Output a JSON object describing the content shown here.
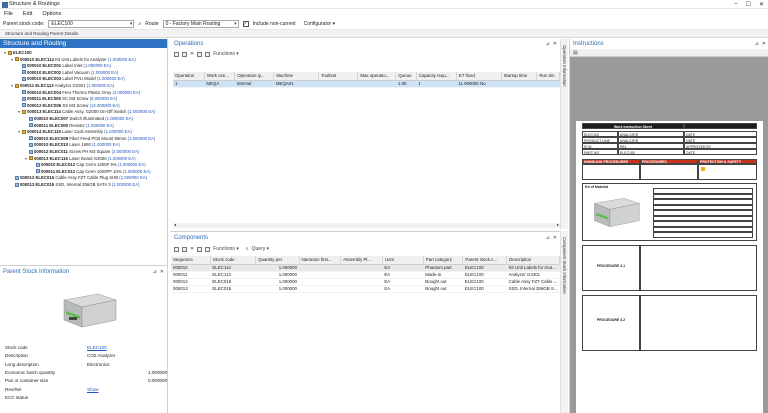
{
  "window": {
    "title": "Structure & Routings",
    "controls": [
      "–",
      "☐",
      "✕"
    ]
  },
  "menu": [
    "File",
    "Edit",
    "Options"
  ],
  "toolbar": {
    "parent_stock_code_label": "Parent stock code:",
    "parent_stock_code_value": "ELEC100",
    "route_label": "Route",
    "route_value": "0 - Factory Main Routing",
    "include_non_current_label": "Include non-current",
    "include_non_current_checked": true,
    "configurator_label": "Configurator"
  },
  "doc_tab": "Structure and Routing Parent Details",
  "structure_panel": {
    "title": "Structure and Routing",
    "rows": [
      {
        "level": 0,
        "icon": "folder",
        "code": "ELEC100",
        "desc": "",
        "qty": ""
      },
      {
        "level": 1,
        "icon": "folder",
        "code": "000010 ELEC114",
        "desc": "Kit Unit Labels for Analyzer",
        "qty": "(1.000000 EA)"
      },
      {
        "level": 2,
        "icon": "item",
        "code": "000010 ELEC001",
        "desc": "Label Inlet",
        "qty": "(1.000000 EA)"
      },
      {
        "level": 2,
        "icon": "item",
        "code": "000010 ELEC002",
        "desc": "Label Vacuum",
        "qty": "(1.000000 EA)"
      },
      {
        "level": 2,
        "icon": "item",
        "code": "000010 ELEC003",
        "desc": "Label PVU Model",
        "qty": "(1.000000 EA)"
      },
      {
        "level": 1,
        "icon": "folder",
        "code": "000011 ELEC113",
        "desc": "Analyzer G2301",
        "qty": "(1.000000 EA)"
      },
      {
        "level": 2,
        "icon": "item",
        "code": "000010 ELEC004",
        "desc": "Feet Thermo Plastic Grey",
        "qty": "(4.000000 EA)"
      },
      {
        "level": 2,
        "icon": "item",
        "code": "000011 ELEC005",
        "desc": "SC M3 Screw",
        "qty": "(8.000000 EA)"
      },
      {
        "level": 2,
        "icon": "item",
        "code": "000012 ELEC006",
        "desc": "SS M3 Screw",
        "qty": "(12.000000 EA)"
      },
      {
        "level": 2,
        "icon": "folder",
        "code": "000013 ELEC114",
        "desc": "Cable Assy, G2000 On-Off Switch",
        "qty": "(1.000000 EA)"
      },
      {
        "level": 3,
        "icon": "item",
        "code": "000010 ELEC007",
        "desc": "Switch Illuminated",
        "qty": "(1.000000 EA)"
      },
      {
        "level": 3,
        "icon": "item",
        "code": "000011 ELEC008",
        "desc": "Resistor",
        "qty": "(1.000000 EA)"
      },
      {
        "level": 2,
        "icon": "folder",
        "code": "000014 ELEC115",
        "desc": "Laser Card Assembly",
        "qty": "(1.000000 EA)"
      },
      {
        "level": 3,
        "icon": "item",
        "code": "000010 ELEC009",
        "desc": "Fiber Feed PCB Mount 80mm",
        "qty": "(1.000000 EA)"
      },
      {
        "level": 3,
        "icon": "item",
        "code": "000010 ELEC010",
        "desc": "Laser 1650",
        "qty": "(1.000000 EA)"
      },
      {
        "level": 3,
        "icon": "item",
        "code": "000012 ELEC011",
        "desc": "Screw PH M3 Square",
        "qty": "(2.000000 EA)"
      },
      {
        "level": 3,
        "icon": "folder",
        "code": "000013 ELEC116",
        "desc": "Laser Board G2000",
        "qty": "(1.000000 EA)"
      },
      {
        "level": 4,
        "icon": "item",
        "code": "000010 ELEC012",
        "desc": "Cap Cerm 1200F 5%",
        "qty": "(1.000000 EA)"
      },
      {
        "level": 4,
        "icon": "item",
        "code": "000011 ELEC013",
        "desc": "Cap Cerm 1000PF 10%",
        "qty": "(1.000000 EA)"
      },
      {
        "level": 1,
        "icon": "item",
        "code": "000012 ELEC016",
        "desc": "Cable Assy FZT Cable Plug SHB",
        "qty": "(1.000000 EA)"
      },
      {
        "level": 1,
        "icon": "item",
        "code": "000013 ELEC015",
        "desc": "SSD, Internal 256GB SATA 3",
        "qty": "(1.000000 EA)"
      }
    ]
  },
  "parent_stock": {
    "title": "Parent Stock Information",
    "fields": [
      {
        "label": "Stock code",
        "value": "ELEC100",
        "link": true,
        "right": ""
      },
      {
        "label": "Description",
        "value": "CO2 Analyzer",
        "link": false,
        "right": ""
      },
      {
        "label": "Long description",
        "value": "Electronics",
        "link": false,
        "right": ""
      },
      {
        "label": "Economic batch quantity",
        "value": "",
        "link": false,
        "right": "1.000000"
      },
      {
        "label": "Pan or container size",
        "value": "",
        "link": false,
        "right": "0.000000"
      },
      {
        "label": "Rev/Rel",
        "value": "Show",
        "link": true,
        "right": ""
      },
      {
        "label": "ECC status",
        "value": "",
        "link": false,
        "right": ""
      }
    ]
  },
  "operations": {
    "title": "Operations",
    "functions_label": "Functions",
    "side_tab": "Operation Information",
    "columns": [
      "Operation",
      "Work cen...",
      "Operation ty...",
      "Machine",
      "Tooltset",
      "Max operatio...",
      "Queue",
      "Capacity requ...",
      "ET fixed",
      "Startup time",
      "Run tim"
    ],
    "rows": [
      [
        "1",
        "MEQA",
        "Internal",
        "MEQA01",
        "",
        "",
        "1.00",
        "1",
        "11.000000 No",
        "",
        ""
      ]
    ]
  },
  "components": {
    "title": "Components",
    "functions_label": "Functions",
    "query_label": "Query",
    "side_tab": "Component Stock Information",
    "columns": [
      "Sequence",
      "Stock code",
      "Quantity per",
      "Narration first...",
      "Assembly Pl...",
      "Uom",
      "Part category",
      "Parent stock c...",
      "Description"
    ],
    "rows": [
      [
        "000010",
        "ELEC114",
        "1.000000",
        "",
        "",
        "EA",
        "Phantom part",
        "ELEC100",
        "Kit Unit Labels for Ana..."
      ],
      [
        "000011",
        "ELEC113",
        "1.000000",
        "",
        "",
        "EA",
        "Made-in",
        "ELEC100",
        "Analyzer G2301"
      ],
      [
        "000012",
        "ELEC016",
        "1.000000",
        "",
        "",
        "EA",
        "Bought out",
        "ELEC100",
        "Cable Assy FZT Cable ..."
      ],
      [
        "000013",
        "ELEC015",
        "1.000000",
        "",
        "",
        "EA",
        "Bought out",
        "ELEC100",
        "SSD, Internal 256GB S..."
      ]
    ]
  },
  "instructions": {
    "title": "Instructions",
    "doc": {
      "heading": "Work Instruction Sheet",
      "meta": [
        [
          "ELEC100",
          "ANALYZER",
          "DATE"
        ],
        [
          "PRODUCT LINE",
          "ANALYZER",
          "DATE"
        ],
        [
          "ECN",
          "REL",
          "APPROVED BY"
        ],
        [
          "PART NO",
          "ELEC100",
          "DATE"
        ]
      ],
      "section_heads": [
        "HANDLING PROCEDURES",
        "PROCEDURES",
        "PROTECTION & SAFETY"
      ],
      "kit_label": "Kit of Material",
      "proc1": "PROCEDURE 3.1",
      "proc2": "PROCEDURE 3.2"
    }
  },
  "colors": {
    "accent": "#2f73c4",
    "selection": "#cfe3f7",
    "link": "#2255bb",
    "doc_red": "#c8321e"
  }
}
